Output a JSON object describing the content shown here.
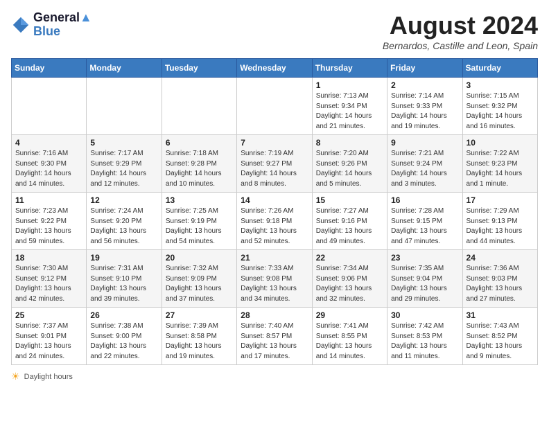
{
  "header": {
    "logo_line1": "General",
    "logo_line2": "Blue",
    "month_year": "August 2024",
    "location": "Bernardos, Castille and Leon, Spain"
  },
  "days_of_week": [
    "Sunday",
    "Monday",
    "Tuesday",
    "Wednesday",
    "Thursday",
    "Friday",
    "Saturday"
  ],
  "weeks": [
    [
      {
        "day": "",
        "info": ""
      },
      {
        "day": "",
        "info": ""
      },
      {
        "day": "",
        "info": ""
      },
      {
        "day": "",
        "info": ""
      },
      {
        "day": "1",
        "info": "Sunrise: 7:13 AM\nSunset: 9:34 PM\nDaylight: 14 hours and 21 minutes."
      },
      {
        "day": "2",
        "info": "Sunrise: 7:14 AM\nSunset: 9:33 PM\nDaylight: 14 hours and 19 minutes."
      },
      {
        "day": "3",
        "info": "Sunrise: 7:15 AM\nSunset: 9:32 PM\nDaylight: 14 hours and 16 minutes."
      }
    ],
    [
      {
        "day": "4",
        "info": "Sunrise: 7:16 AM\nSunset: 9:30 PM\nDaylight: 14 hours and 14 minutes."
      },
      {
        "day": "5",
        "info": "Sunrise: 7:17 AM\nSunset: 9:29 PM\nDaylight: 14 hours and 12 minutes."
      },
      {
        "day": "6",
        "info": "Sunrise: 7:18 AM\nSunset: 9:28 PM\nDaylight: 14 hours and 10 minutes."
      },
      {
        "day": "7",
        "info": "Sunrise: 7:19 AM\nSunset: 9:27 PM\nDaylight: 14 hours and 8 minutes."
      },
      {
        "day": "8",
        "info": "Sunrise: 7:20 AM\nSunset: 9:26 PM\nDaylight: 14 hours and 5 minutes."
      },
      {
        "day": "9",
        "info": "Sunrise: 7:21 AM\nSunset: 9:24 PM\nDaylight: 14 hours and 3 minutes."
      },
      {
        "day": "10",
        "info": "Sunrise: 7:22 AM\nSunset: 9:23 PM\nDaylight: 14 hours and 1 minute."
      }
    ],
    [
      {
        "day": "11",
        "info": "Sunrise: 7:23 AM\nSunset: 9:22 PM\nDaylight: 13 hours and 59 minutes."
      },
      {
        "day": "12",
        "info": "Sunrise: 7:24 AM\nSunset: 9:20 PM\nDaylight: 13 hours and 56 minutes."
      },
      {
        "day": "13",
        "info": "Sunrise: 7:25 AM\nSunset: 9:19 PM\nDaylight: 13 hours and 54 minutes."
      },
      {
        "day": "14",
        "info": "Sunrise: 7:26 AM\nSunset: 9:18 PM\nDaylight: 13 hours and 52 minutes."
      },
      {
        "day": "15",
        "info": "Sunrise: 7:27 AM\nSunset: 9:16 PM\nDaylight: 13 hours and 49 minutes."
      },
      {
        "day": "16",
        "info": "Sunrise: 7:28 AM\nSunset: 9:15 PM\nDaylight: 13 hours and 47 minutes."
      },
      {
        "day": "17",
        "info": "Sunrise: 7:29 AM\nSunset: 9:13 PM\nDaylight: 13 hours and 44 minutes."
      }
    ],
    [
      {
        "day": "18",
        "info": "Sunrise: 7:30 AM\nSunset: 9:12 PM\nDaylight: 13 hours and 42 minutes."
      },
      {
        "day": "19",
        "info": "Sunrise: 7:31 AM\nSunset: 9:10 PM\nDaylight: 13 hours and 39 minutes."
      },
      {
        "day": "20",
        "info": "Sunrise: 7:32 AM\nSunset: 9:09 PM\nDaylight: 13 hours and 37 minutes."
      },
      {
        "day": "21",
        "info": "Sunrise: 7:33 AM\nSunset: 9:08 PM\nDaylight: 13 hours and 34 minutes."
      },
      {
        "day": "22",
        "info": "Sunrise: 7:34 AM\nSunset: 9:06 PM\nDaylight: 13 hours and 32 minutes."
      },
      {
        "day": "23",
        "info": "Sunrise: 7:35 AM\nSunset: 9:04 PM\nDaylight: 13 hours and 29 minutes."
      },
      {
        "day": "24",
        "info": "Sunrise: 7:36 AM\nSunset: 9:03 PM\nDaylight: 13 hours and 27 minutes."
      }
    ],
    [
      {
        "day": "25",
        "info": "Sunrise: 7:37 AM\nSunset: 9:01 PM\nDaylight: 13 hours and 24 minutes."
      },
      {
        "day": "26",
        "info": "Sunrise: 7:38 AM\nSunset: 9:00 PM\nDaylight: 13 hours and 22 minutes."
      },
      {
        "day": "27",
        "info": "Sunrise: 7:39 AM\nSunset: 8:58 PM\nDaylight: 13 hours and 19 minutes."
      },
      {
        "day": "28",
        "info": "Sunrise: 7:40 AM\nSunset: 8:57 PM\nDaylight: 13 hours and 17 minutes."
      },
      {
        "day": "29",
        "info": "Sunrise: 7:41 AM\nSunset: 8:55 PM\nDaylight: 13 hours and 14 minutes."
      },
      {
        "day": "30",
        "info": "Sunrise: 7:42 AM\nSunset: 8:53 PM\nDaylight: 13 hours and 11 minutes."
      },
      {
        "day": "31",
        "info": "Sunrise: 7:43 AM\nSunset: 8:52 PM\nDaylight: 13 hours and 9 minutes."
      }
    ]
  ],
  "footer": {
    "note": "Daylight hours"
  }
}
